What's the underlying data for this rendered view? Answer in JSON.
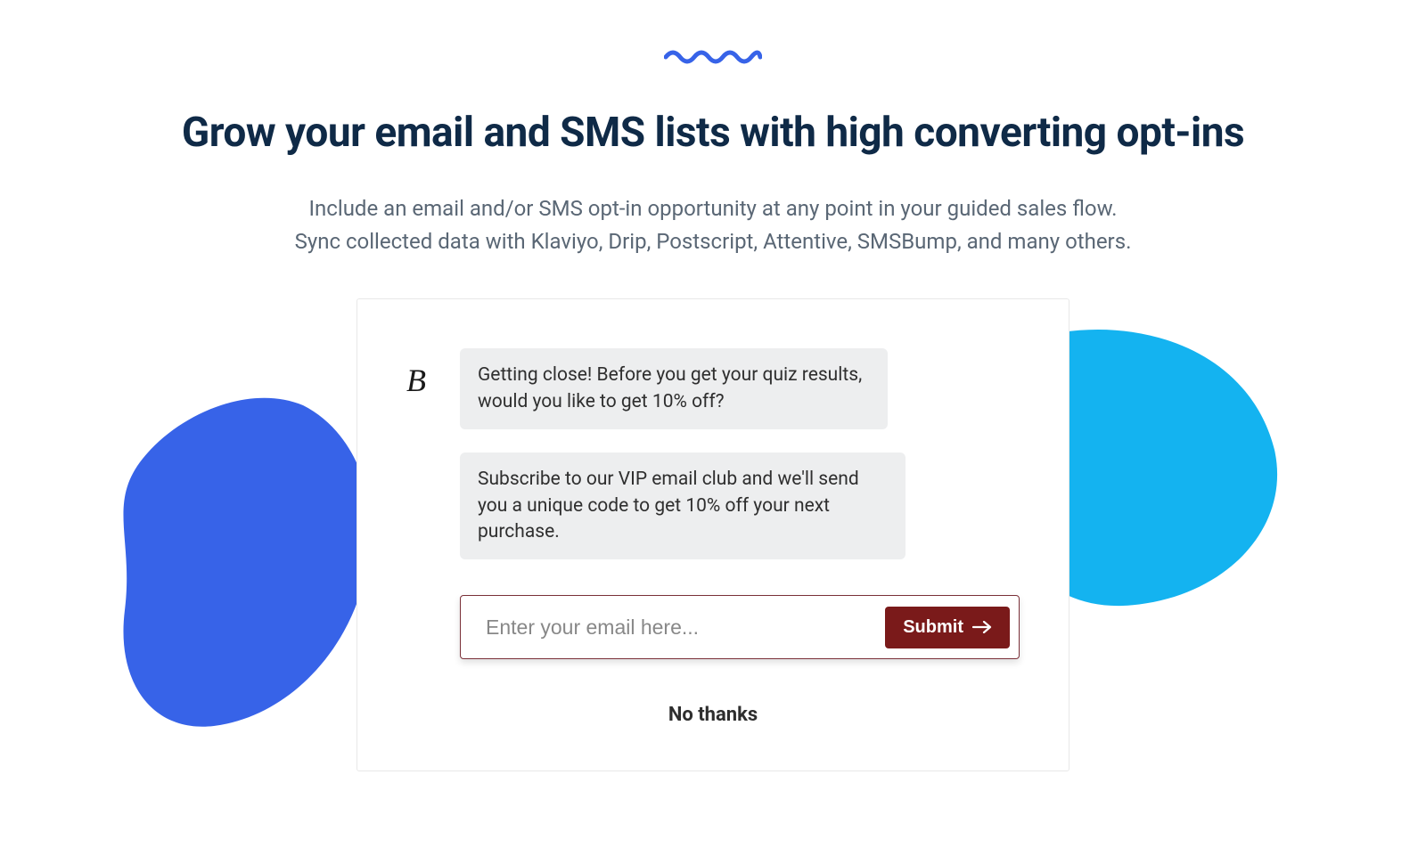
{
  "headline": "Grow your email and SMS lists with high converting opt-ins",
  "subhead_line1": "Include an email and/or SMS opt-in opportunity at any point in your guided sales flow.",
  "subhead_line2": "Sync collected data with Klaviyo, Drip, Postscript, Attentive, SMSBump, and many others.",
  "card": {
    "avatar_mark": "B",
    "bubble1": "Getting close! Before you get your quiz results, would you like to get 10% off?",
    "bubble2": "Subscribe to our VIP email club and we'll send you a unique code to get 10% off your next purchase.",
    "email_placeholder": "Enter your email here...",
    "submit_label": "Submit",
    "no_thanks": "No thanks"
  },
  "colors": {
    "squiggle": "#3763e8",
    "blob_left": "#3763e8",
    "blob_right": "#14b3f0",
    "submit_bg": "#7a1a1a",
    "input_border": "#7a3038"
  }
}
